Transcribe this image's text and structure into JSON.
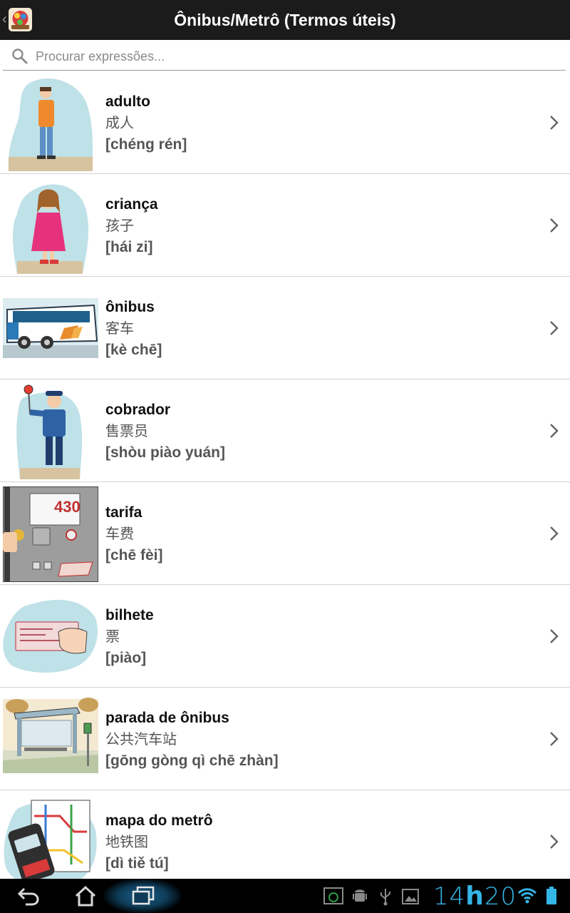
{
  "header": {
    "title": "Ônibus/Metrô (Termos úteis)",
    "back_glyph": "‹"
  },
  "search": {
    "placeholder": "Procurar expressões...",
    "value": ""
  },
  "items": [
    {
      "pt": "adulto",
      "zh": "成人",
      "pinyin": "[chéng rén]",
      "image": "adult-man-illustration"
    },
    {
      "pt": "criança",
      "zh": "孩子",
      "pinyin": "[hái zi]",
      "image": "child-girl-illustration"
    },
    {
      "pt": "ônibus",
      "zh": "客车",
      "pinyin": "[kè chē]",
      "image": "bus-illustration"
    },
    {
      "pt": "cobrador",
      "zh": "售票员",
      "pinyin": "[shòu piào yuán]",
      "image": "conductor-illustration"
    },
    {
      "pt": "tarifa",
      "zh": "车费",
      "pinyin": "[chē fèi]",
      "image": "fare-machine-illustration"
    },
    {
      "pt": "bilhete",
      "zh": "票",
      "pinyin": "[piào]",
      "image": "ticket-illustration"
    },
    {
      "pt": "parada de ônibus",
      "zh": "公共汽车站",
      "pinyin": "[gōng gòng qì chē zhàn]",
      "image": "bus-stop-illustration"
    },
    {
      "pt": "mapa do metrô",
      "zh": "地铁图",
      "pinyin": "[dì tiě tú]",
      "image": "subway-map-illustration"
    }
  ],
  "fare_display": "430",
  "statusbar": {
    "clock_hours": "14",
    "clock_sep": "h",
    "clock_minutes": "20"
  },
  "colors": {
    "accent": "#33b5e5",
    "topbar": "#1b1b1b",
    "navbar": "#000000"
  }
}
